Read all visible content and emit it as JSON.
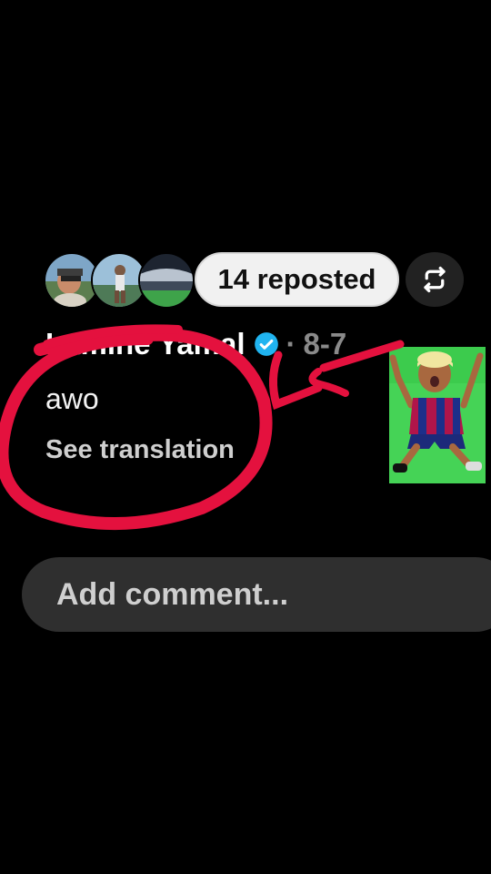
{
  "repost": {
    "label": "14 reposted",
    "icon": "repost-icon"
  },
  "comment": {
    "author": "Lamine Yamal",
    "verified_icon": "verified-badge-icon",
    "separator": "·",
    "date": "8-7",
    "text": "awo",
    "see_translation": "See translation"
  },
  "composer": {
    "placeholder": "Add comment..."
  },
  "colors": {
    "background": "#000000",
    "verified": "#20b4f0",
    "annotation": "#e4113e",
    "pill": "#f1f1f1",
    "input_bg": "#2f2f2f"
  }
}
